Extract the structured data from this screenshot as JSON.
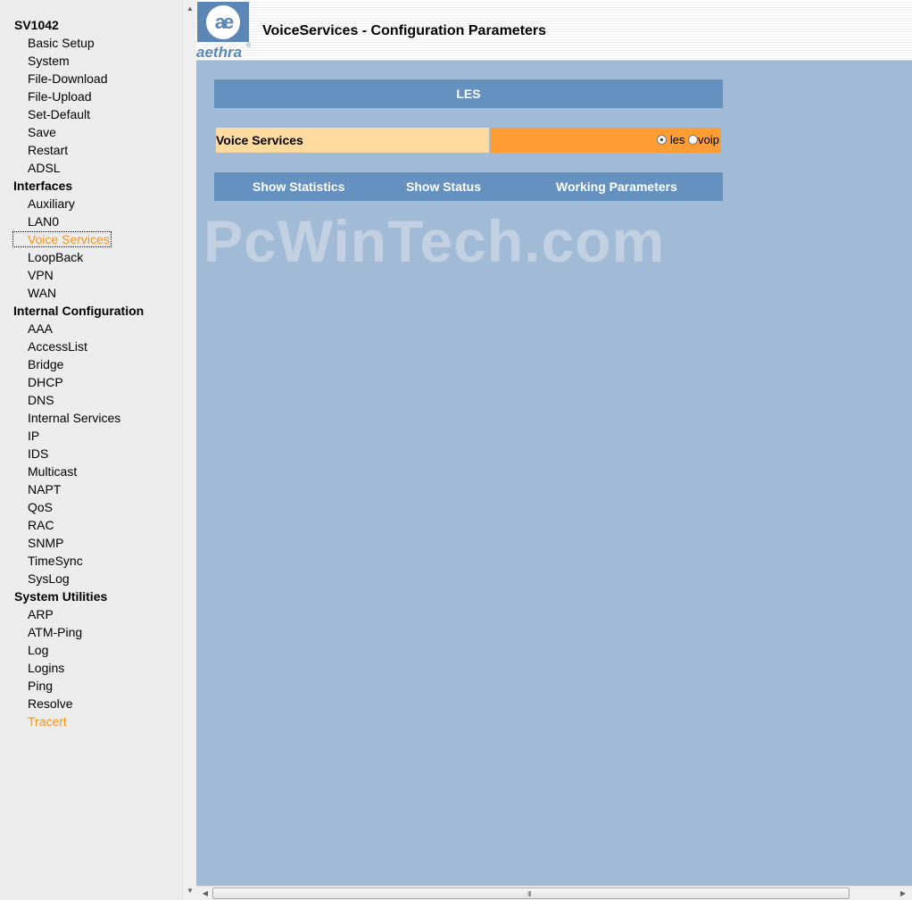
{
  "nav": {
    "device": "SV1042",
    "groups": [
      {
        "heading": "",
        "items": [
          "Basic Setup",
          "System",
          "File-Download",
          "File-Upload",
          "Set-Default",
          "Save",
          "Restart",
          "ADSL"
        ]
      },
      {
        "heading": "Interfaces",
        "items": [
          "Auxiliary",
          "LAN0",
          "Voice Services",
          "LoopBack",
          "VPN",
          "WAN"
        ]
      },
      {
        "heading": "Internal Configuration",
        "items": [
          "AAA",
          "AccessList",
          "Bridge",
          "DHCP",
          "DNS",
          "Internal Services",
          "IP",
          "IDS",
          "Multicast",
          "NAPT",
          "QoS",
          "RAC",
          "SNMP",
          "TimeSync",
          "SysLog"
        ]
      },
      {
        "heading": "System Utilities",
        "items": [
          "ARP",
          "ATM-Ping",
          "Log",
          "Logins",
          "Ping",
          "Resolve",
          "Tracert"
        ]
      }
    ],
    "active_item": "Voice Services",
    "visited_item": "Tracert"
  },
  "header": {
    "logo_mark": "ae",
    "logo_text": "aethra",
    "logo_reg": "®",
    "title": "VoiceServices - Configuration Parameters"
  },
  "watermark": "PcWinTech.com",
  "section": {
    "title": "LES"
  },
  "voice_services": {
    "label": "Voice Services",
    "options": [
      {
        "label": "les",
        "checked": true
      },
      {
        "label": "voip",
        "checked": false
      }
    ]
  },
  "actions": {
    "show_statistics": "Show Statistics",
    "show_status": "Show Status",
    "working_parameters": "Working Parameters"
  },
  "scrollbar": {
    "grip": "III"
  },
  "colors": {
    "page_bg": "#a1bbd7",
    "bar_blue": "#6591c1",
    "label_cell": "#ffdba0",
    "option_cell": "#ff9c34",
    "active_link": "#f7941d"
  }
}
